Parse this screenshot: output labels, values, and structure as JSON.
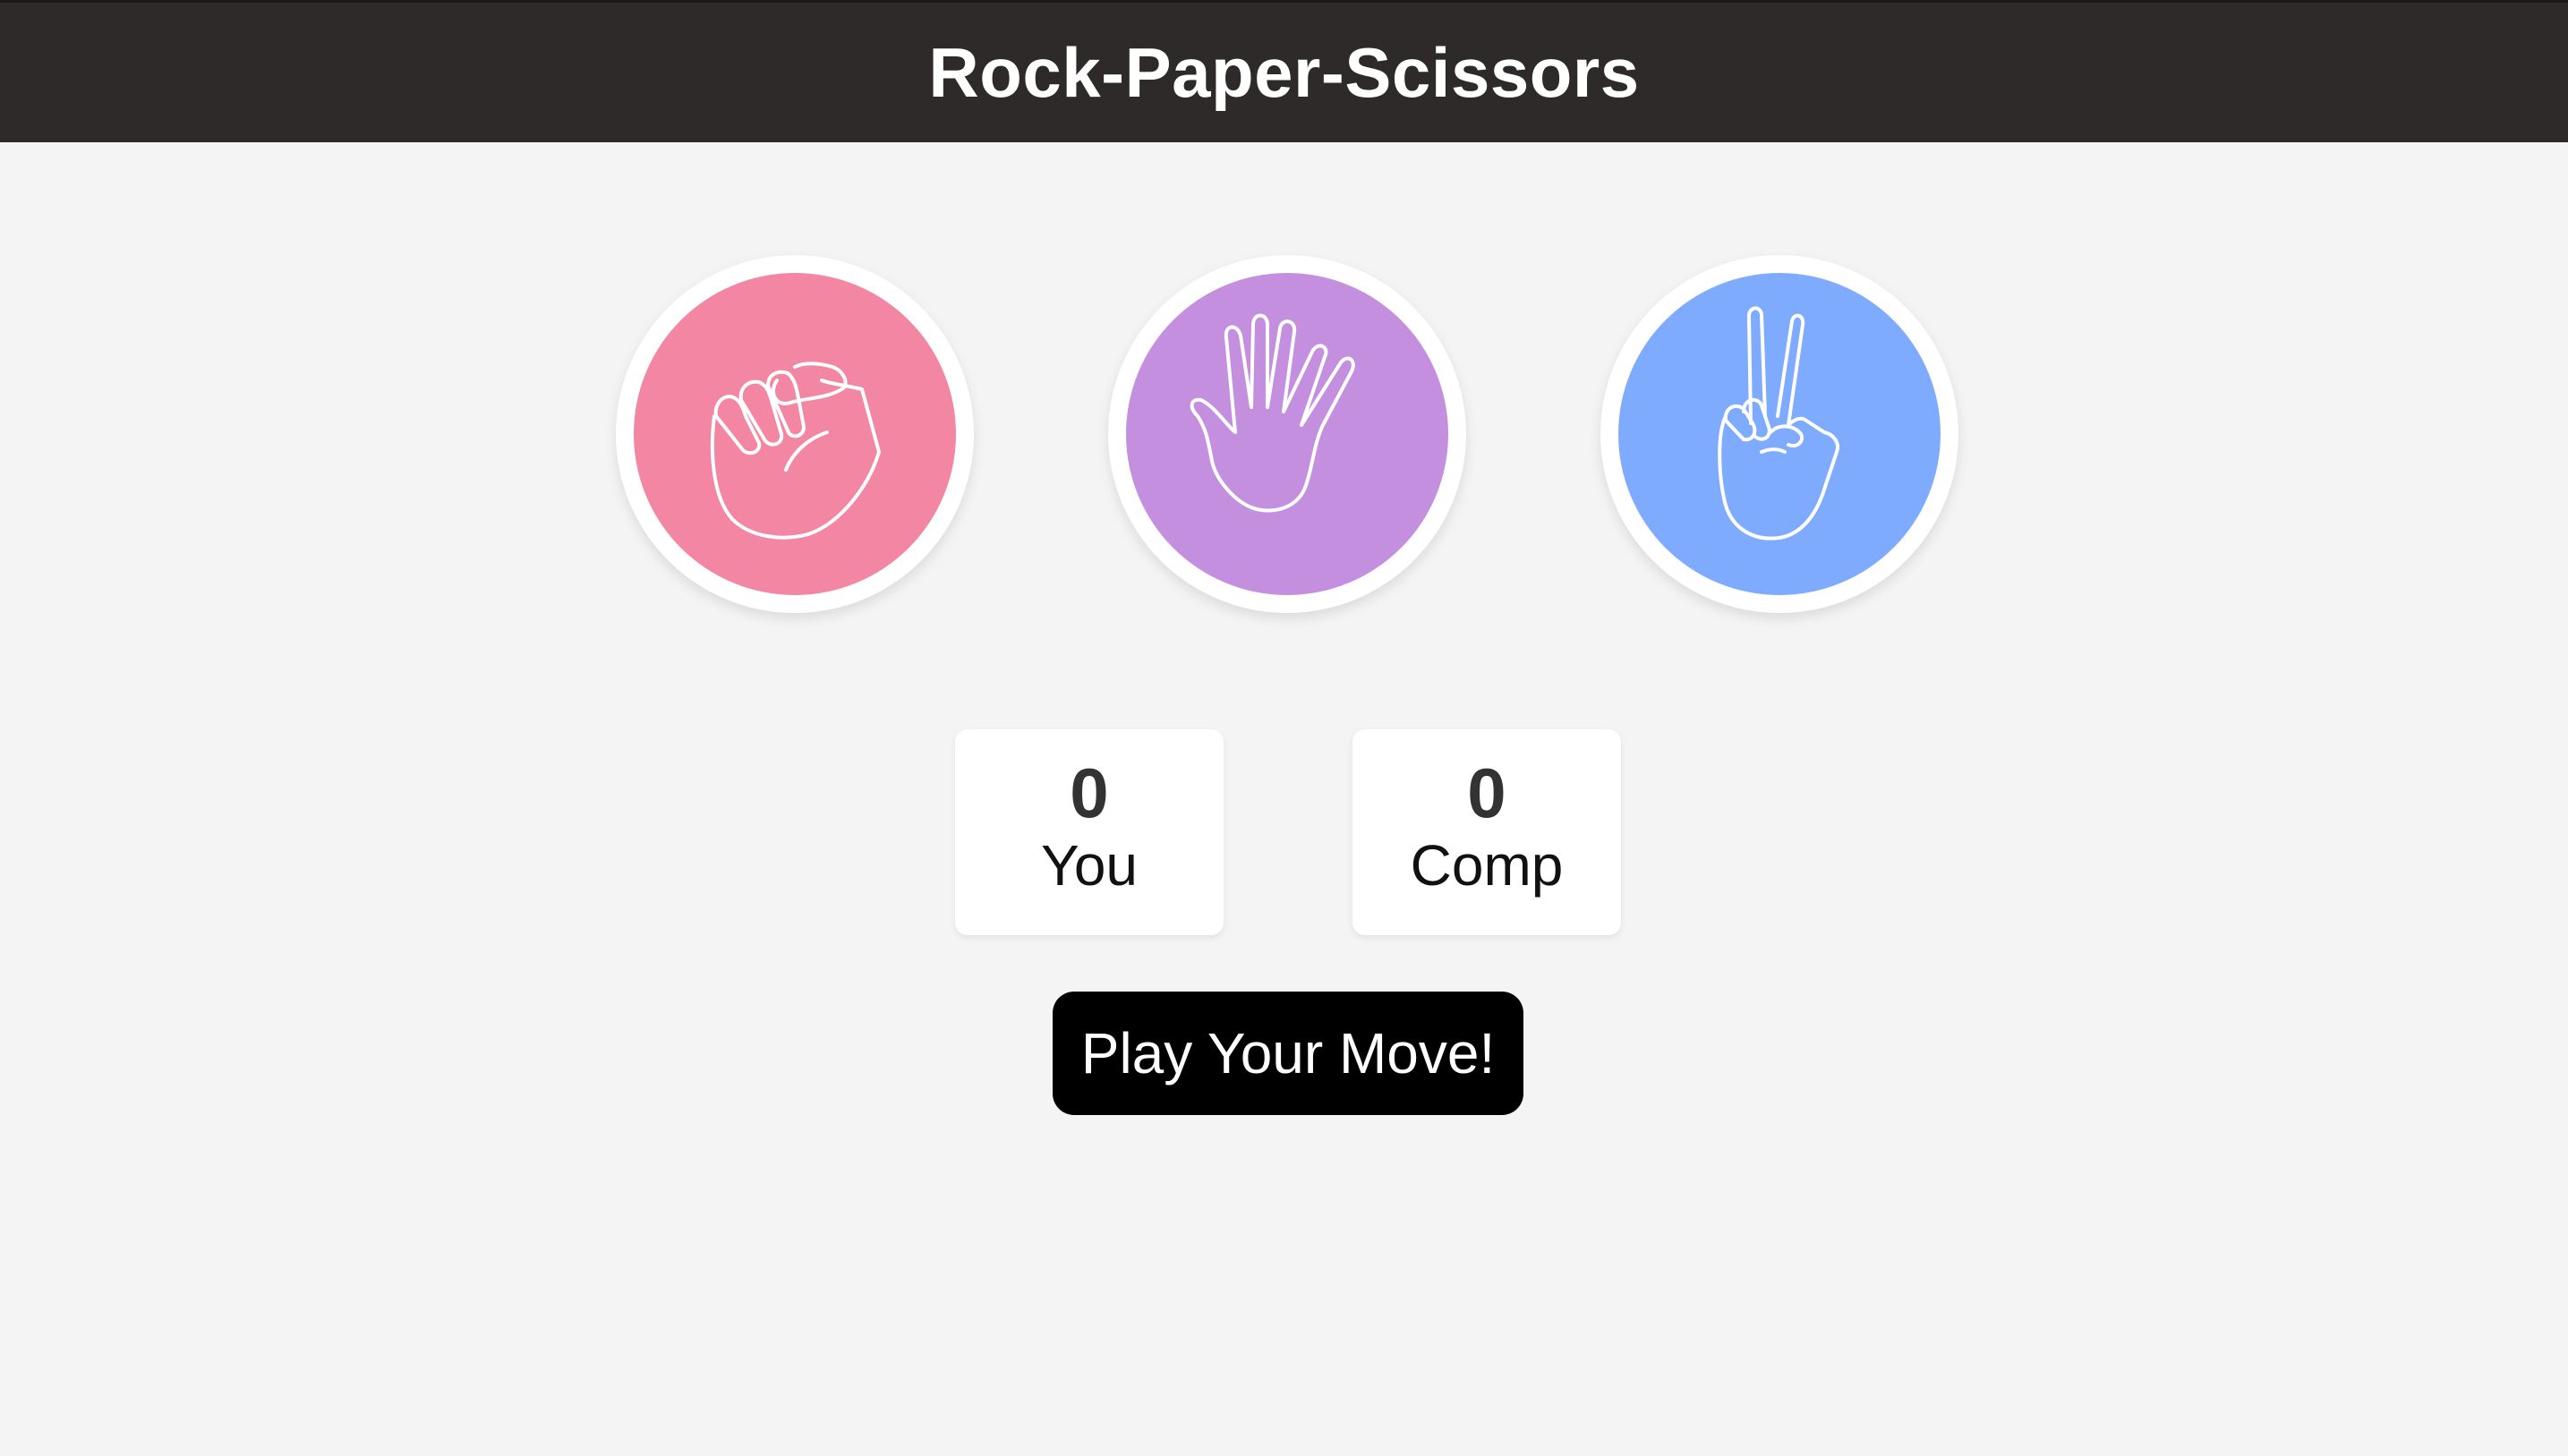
{
  "header": {
    "title": "Rock-Paper-Scissors",
    "background": "#2d2a29"
  },
  "choices": [
    {
      "name": "rock",
      "icon": "fist-icon",
      "color": "#f286a3"
    },
    {
      "name": "paper",
      "icon": "open-hand-icon",
      "color": "#c38fde"
    },
    {
      "name": "scissors",
      "icon": "peace-hand-icon",
      "color": "#7fabff"
    }
  ],
  "scores": {
    "you": {
      "value": "0",
      "label": "You"
    },
    "comp": {
      "value": "0",
      "label": "Comp"
    }
  },
  "message": {
    "label": "Play Your Move!",
    "background": "#000000"
  }
}
